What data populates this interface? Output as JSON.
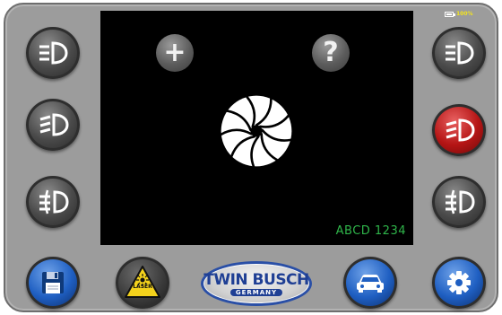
{
  "screen": {
    "plate_text": "ABCD 1234",
    "add_symbol": "+",
    "help_symbol": "?"
  },
  "status": {
    "battery_text": "100%"
  },
  "left_column": [
    {
      "icon": "low-beam-icon"
    },
    {
      "icon": "fog-light-icon"
    },
    {
      "icon": "rear-fog-light-icon"
    }
  ],
  "right_column": [
    {
      "icon": "low-beam-icon",
      "color": "grey"
    },
    {
      "icon": "fog-light-icon",
      "color": "red",
      "active": true
    },
    {
      "icon": "rear-fog-light-icon",
      "color": "grey"
    }
  ],
  "bottom_bar": {
    "save_icon": "floppy-disk-icon",
    "laser_label": "LASER",
    "laser_icon": "laser-warning-icon",
    "logo_main": "TWIN BUSCH",
    "logo_sub": "GERMANY",
    "vehicle_icon": "car-icon",
    "settings_icon": "gear-icon"
  },
  "colors": {
    "frame": "#9c9c9c",
    "screen": "#000000",
    "plate_text": "#2fb54a",
    "active_button": "#b51515",
    "blue_button": "#1f5fc2",
    "laser_warning": "#f4d21c",
    "logo_blue": "#1f3f94"
  }
}
